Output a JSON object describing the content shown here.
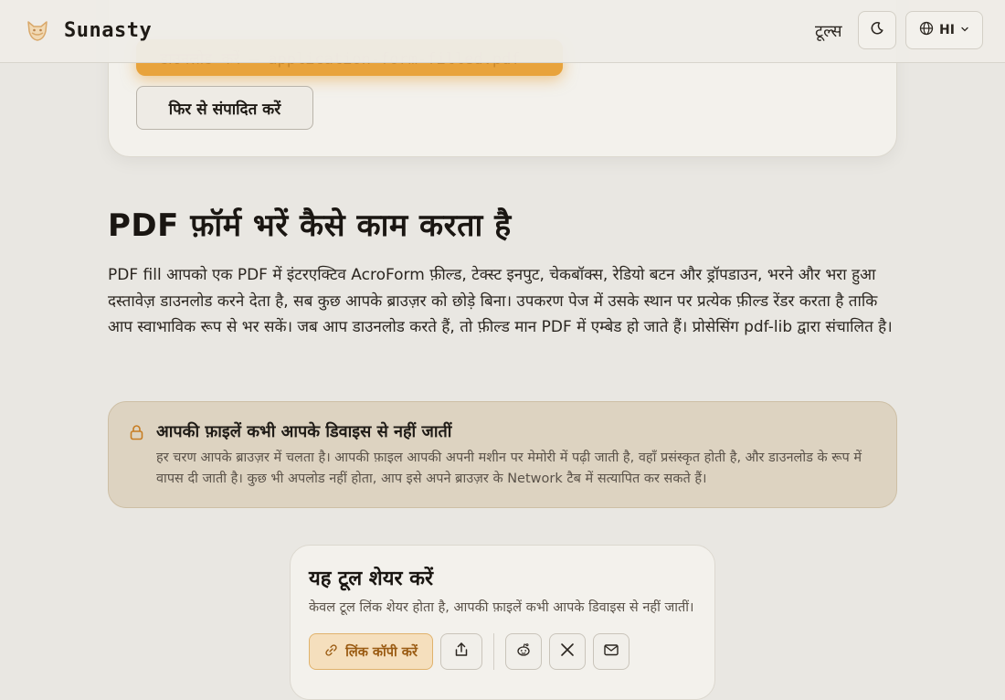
{
  "header": {
    "brand": "Sunasty",
    "nav_tools": "टूल्स",
    "language": "HI"
  },
  "result": {
    "download_label": "डाउनलोड करें — application-form-filled.pdf",
    "edit_again_label": "फिर से संपादित करें"
  },
  "how_it_works": {
    "title": "PDF फ़ॉर्म भरें कैसे काम करता है",
    "body": "PDF fill आपको एक PDF में इंटरएक्टिव AcroForm फ़ील्ड, टेक्स्ट इनपुट, चेकबॉक्स, रेडियो बटन और ड्रॉपडाउन, भरने और भरा हुआ दस्तावेज़ डाउनलोड करने देता है, सब कुछ आपके ब्राउज़र को छोड़े बिना। उपकरण पेज में उसके स्थान पर प्रत्येक फ़ील्ड रेंडर करता है ताकि आप स्वाभाविक रूप से भर सकें। जब आप डाउनलोड करते हैं, तो फ़ील्ड मान PDF में एम्बेड हो जाते हैं। प्रोसेसिंग pdf-lib द्वारा संचालित है।"
  },
  "privacy": {
    "title": "आपकी फ़ाइलें कभी आपके डिवाइस से नहीं जातीं",
    "text": "हर चरण आपके ब्राउज़र में चलता है। आपकी फ़ाइल आपकी अपनी मशीन पर मेमोरी में पढ़ी जाती है, वहाँ प्रसंस्कृत होती है, और डाउनलोड के रूप में वापस दी जाती है। कुछ भी अपलोड नहीं होता, आप इसे अपने ब्राउज़र के Network टैब में सत्यापित कर सकते हैं।"
  },
  "share": {
    "title": "यह टूल शेयर करें",
    "subtitle": "केवल टूल लिंक शेयर होता है, आपकी फ़ाइलें कभी आपके डिवाइस से नहीं जातीं।",
    "copy_link_label": "लिंक कॉपी करें"
  },
  "icons": {
    "logo": "fox-logo-icon",
    "theme": "moon-icon",
    "language": "globe-icon",
    "dropdown": "chevron-down-icon",
    "privacy": "lock-icon",
    "copy": "link-icon",
    "share": "share-icon",
    "reddit": "reddit-icon",
    "x": "x-icon",
    "email": "mail-icon"
  },
  "colors": {
    "accent": "#e8a33c",
    "background": "#e9e7e2",
    "privacy_bg": "#ddd3c1",
    "copy_btn_text": "#9a5b12"
  }
}
